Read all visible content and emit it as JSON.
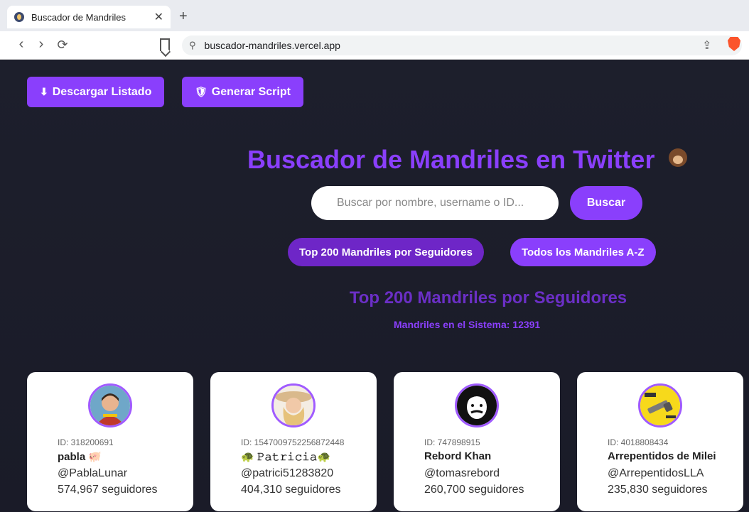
{
  "browser": {
    "tab_title": "Buscador de Mandriles",
    "close_glyph": "✕",
    "newtab_glyph": "+",
    "url": "buscador-mandriles.vercel.app"
  },
  "top_buttons": {
    "download_label": "Descargar Listado",
    "script_label": "Generar Script"
  },
  "heading": "Buscador de Mandriles en Twitter",
  "search": {
    "placeholder": "Buscar por nombre, username o ID...",
    "button_label": "Buscar"
  },
  "filters": {
    "top200_label": "Top 200 Mandriles por Seguidores",
    "az_label": "Todos los Mandriles A-Z"
  },
  "section_title": "Top 200 Mandriles por Seguidores",
  "count_text": "Mandriles en el Sistema: 12391",
  "cards": [
    {
      "id": "ID: 318200691",
      "name": "pabla 🐖",
      "user": "@PablaLunar",
      "followers": "574,967 seguidores"
    },
    {
      "id": "ID: 1547009752256872448",
      "name": "🐢 𝙿𝚊𝚝𝚛𝚒𝚌𝚒𝚊🐢",
      "user": "@patrici51283820",
      "followers": "404,310 seguidores"
    },
    {
      "id": "ID: 747898915",
      "name": "Rebord Khan",
      "user": "@tomasrebord",
      "followers": "260,700 seguidores"
    },
    {
      "id": "ID: 4018808434",
      "name": "Arrepentidos de Milei",
      "user": "@ArrepentidosLLA",
      "followers": "235,830 seguidores"
    }
  ],
  "colors": {
    "accent": "#8a3ffc",
    "accent_dark": "#6e26c7",
    "background": "#1b1b29"
  }
}
